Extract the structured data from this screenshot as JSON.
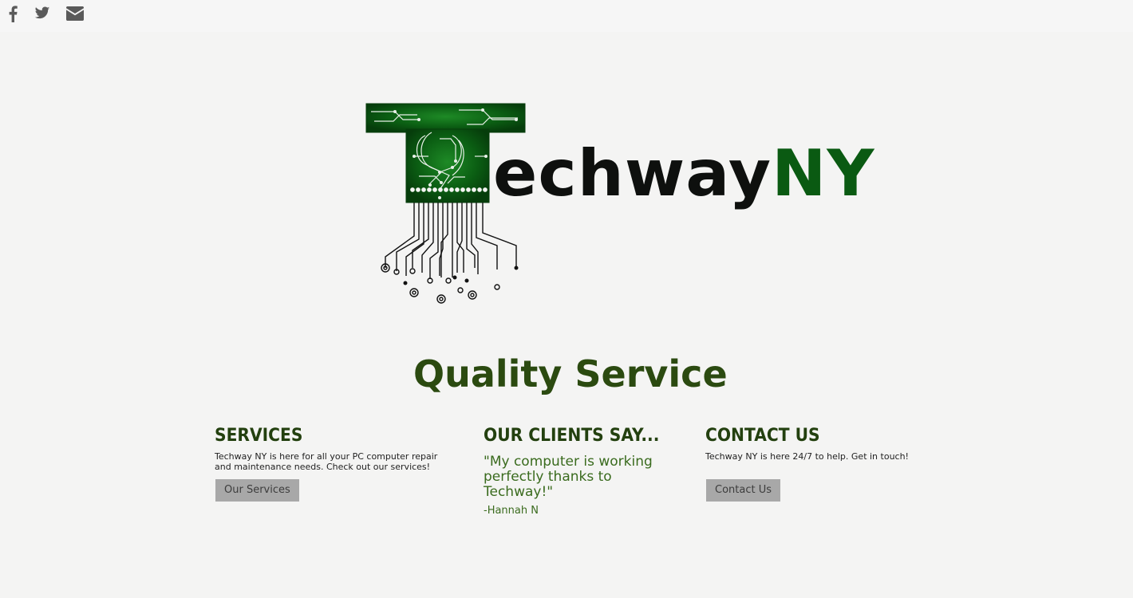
{
  "header": {
    "social": [
      {
        "name": "facebook-icon",
        "label": "Facebook"
      },
      {
        "name": "twitter-icon",
        "label": "Twitter"
      },
      {
        "name": "envelope-icon",
        "label": "Email"
      }
    ],
    "icon_color": "#5a5a5a"
  },
  "logo": {
    "wordmark_dark": "echway",
    "wordmark_green": "NY",
    "chip_color": "#0a5a12"
  },
  "tagline": "Quality Service",
  "services": {
    "heading": "SERVICES",
    "text": "Techway NY is here for all your PC computer repair and maintenance needs. Check out our services!",
    "button": "Our Services"
  },
  "clients": {
    "heading": "OUR CLIENTS SAY...",
    "quote": "\"My computer is working perfectly thanks to Techway!\"",
    "author": "-Hannah N"
  },
  "contact": {
    "heading": "CONTACT US",
    "text": "Techway NY is here 24/7 to help. Get in touch!",
    "button": "Contact Us"
  },
  "colors": {
    "heading": "#23400f",
    "accent_green": "#3a6b1e",
    "button_bg": "#a8a8a8"
  }
}
